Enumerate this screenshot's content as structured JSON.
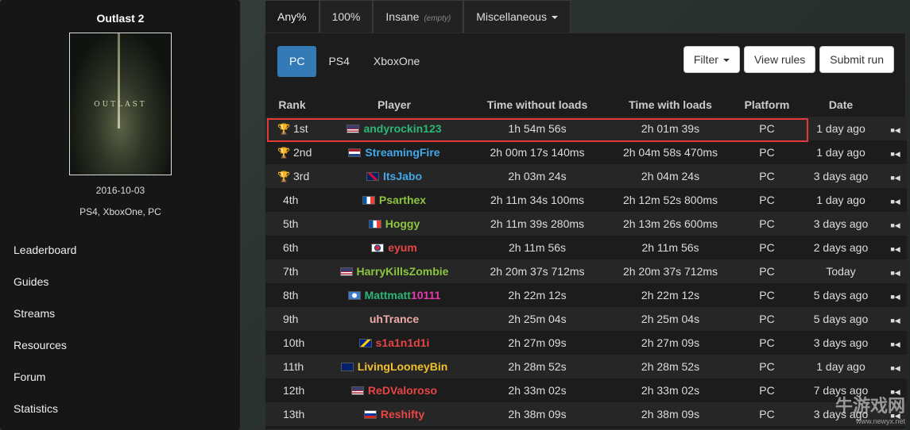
{
  "sidebar": {
    "game_title": "Outlast 2",
    "cover_logo": "OUTLAST",
    "release_date": "2016-10-03",
    "platforms": "PS4, XboxOne, PC",
    "nav": [
      "Leaderboard",
      "Guides",
      "Streams",
      "Resources",
      "Forum",
      "Statistics"
    ]
  },
  "category_tabs": [
    {
      "label": "Any%",
      "active": true
    },
    {
      "label": "100%"
    },
    {
      "label": "Insane",
      "note": "(empty)"
    },
    {
      "label": "Miscellaneous",
      "dropdown": true
    }
  ],
  "platform_tabs": [
    {
      "label": "PC",
      "active": true
    },
    {
      "label": "PS4"
    },
    {
      "label": "XboxOne"
    }
  ],
  "actions": {
    "filter": "Filter",
    "view_rules": "View rules",
    "submit_run": "Submit run"
  },
  "table": {
    "headers": [
      "Rank",
      "Player",
      "Time without loads",
      "Time with loads",
      "Platform",
      "Date"
    ],
    "rows": [
      {
        "rank": "1st",
        "trophy": "gold",
        "flag": "us",
        "player": "andyrockin123",
        "color": "#2bb673",
        "time_nl": "1h 54m 56s",
        "time_l": "2h 01m 39s",
        "platform": "PC",
        "date": "1 day ago"
      },
      {
        "rank": "2nd",
        "trophy": "silver",
        "flag": "nl",
        "player": "StreamingFire",
        "color": "#42a8e8",
        "time_nl": "2h 00m 17s 140ms",
        "time_l": "2h 04m 58s 470ms",
        "platform": "PC",
        "date": "1 day ago"
      },
      {
        "rank": "3rd",
        "trophy": "bronze",
        "flag": "gb",
        "player": "ItsJabo",
        "color": "#42a8e8",
        "time_nl": "2h 03m 24s",
        "time_l": "2h 04m 24s",
        "platform": "PC",
        "date": "3 days ago"
      },
      {
        "rank": "4th",
        "trophy": "none",
        "flag": "fr",
        "player": "Psarthex",
        "color": "#8cc63f",
        "time_nl": "2h 11m 34s 100ms",
        "time_l": "2h 12m 52s 800ms",
        "platform": "PC",
        "date": "1 day ago"
      },
      {
        "rank": "5th",
        "trophy": "none",
        "flag": "fr",
        "player": "Hoggy",
        "color": "#8cc63f",
        "time_nl": "2h 11m 39s 280ms",
        "time_l": "2h 13m 26s 600ms",
        "platform": "PC",
        "date": "3 days ago"
      },
      {
        "rank": "6th",
        "trophy": "none",
        "flag": "kr",
        "player": "eyum",
        "color": "#e84545",
        "time_nl": "2h 11m 56s",
        "time_l": "2h 11m 56s",
        "platform": "PC",
        "date": "2 days ago"
      },
      {
        "rank": "7th",
        "trophy": "none",
        "flag": "us",
        "player": "HarryKillsZombie",
        "color": "#8cc63f",
        "time_nl": "2h 20m 37s 712ms",
        "time_l": "2h 20m 37s 712ms",
        "platform": "PC",
        "date": "Today"
      },
      {
        "rank": "8th",
        "trophy": "none",
        "flag": "aq",
        "player": "Mattmatt10111",
        "color": "#2bb673",
        "player_suffix_color": "#e83ab0",
        "time_nl": "2h 22m 12s",
        "time_l": "2h 22m 12s",
        "platform": "PC",
        "date": "5 days ago"
      },
      {
        "rank": "9th",
        "trophy": "none",
        "flag": "none",
        "player": "uhTrance",
        "color": "#f0a8a8",
        "time_nl": "2h 25m 04s",
        "time_l": "2h 25m 04s",
        "platform": "PC",
        "date": "5 days ago"
      },
      {
        "rank": "10th",
        "trophy": "none",
        "flag": "ba",
        "player": "s1a1n1d1i",
        "color": "#e84545",
        "time_nl": "2h 27m 09s",
        "time_l": "2h 27m 09s",
        "platform": "PC",
        "date": "3 days ago"
      },
      {
        "rank": "11th",
        "trophy": "none",
        "flag": "au",
        "player": "LivingLooneyBin",
        "color": "#f2c12e",
        "time_nl": "2h 28m 52s",
        "time_l": "2h 28m 52s",
        "platform": "PC",
        "date": "1 day ago"
      },
      {
        "rank": "12th",
        "trophy": "none",
        "flag": "us",
        "player": "ReDValoroso",
        "color": "#e84545",
        "time_nl": "2h 33m 02s",
        "time_l": "2h 33m 02s",
        "platform": "PC",
        "date": "7 days ago"
      },
      {
        "rank": "13th",
        "trophy": "none",
        "flag": "ru",
        "player": "Reshifty",
        "color": "#e84545",
        "time_nl": "2h 38m 09s",
        "time_l": "2h 38m 09s",
        "platform": "PC",
        "date": "3 days ago"
      }
    ]
  },
  "watermark": {
    "main": "牛游戏网",
    "sub": "www.newyx.net"
  }
}
